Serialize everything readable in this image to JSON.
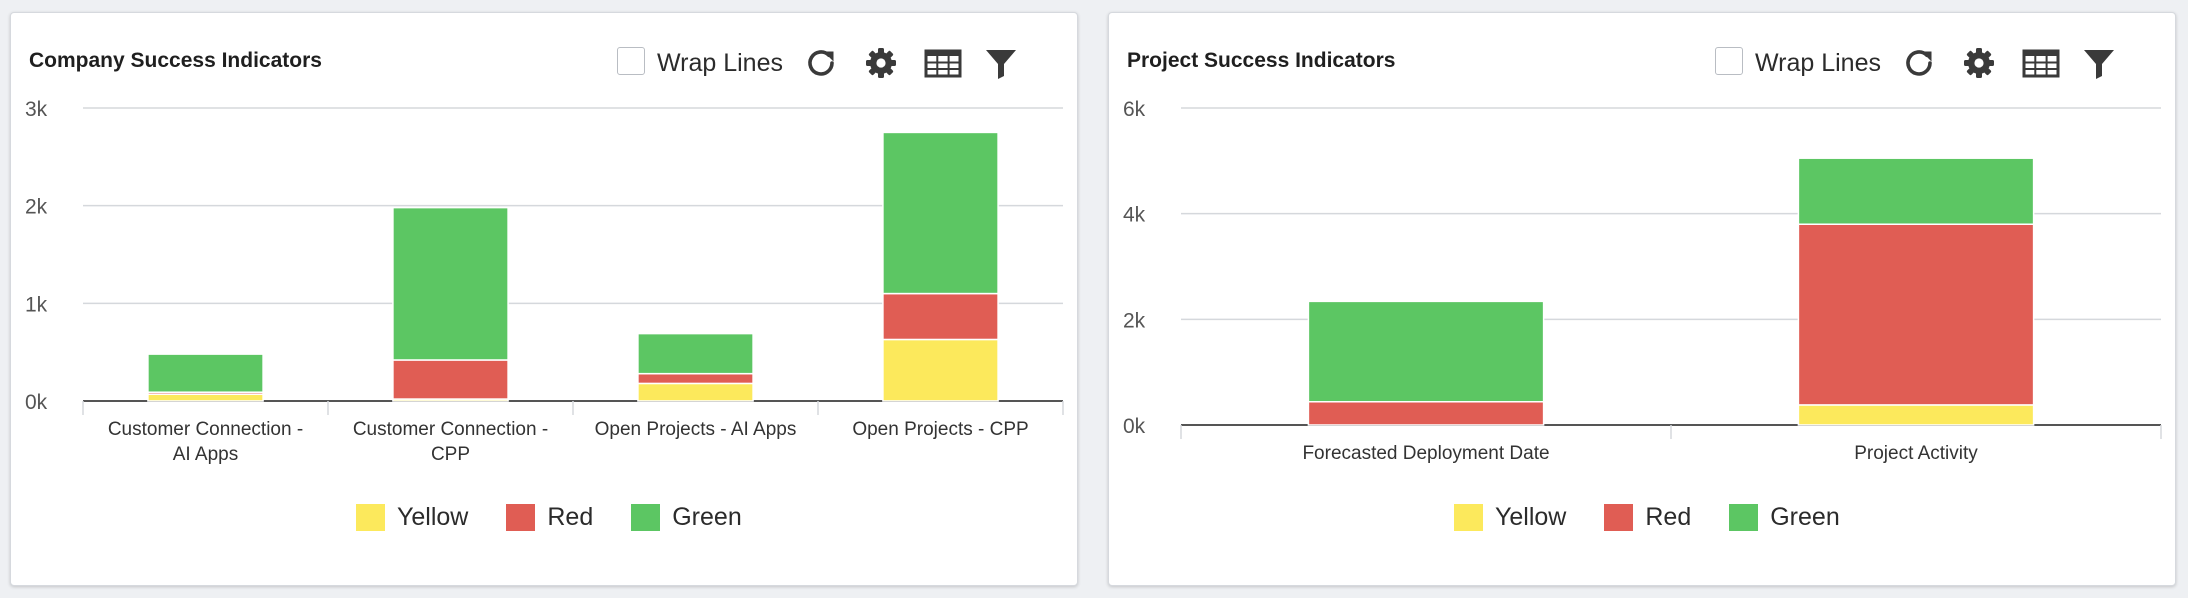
{
  "colors": {
    "yellow": "#fce95c",
    "red": "#e05d54",
    "green": "#5cc663",
    "grid": "#d5d8dc",
    "axis": "#555555",
    "icon": "#3a3a3a"
  },
  "toolbar": {
    "wrap_lines_label": "Wrap Lines",
    "icons": [
      "refresh-icon",
      "gear-icon",
      "table-icon",
      "filter-icon"
    ]
  },
  "panels": [
    {
      "title": "Company Success Indicators"
    },
    {
      "title": "Project Success Indicators"
    }
  ],
  "chart_data": [
    {
      "type": "bar",
      "stacked": true,
      "title": "Company Success Indicators",
      "xlabel": "",
      "ylabel": "",
      "ylim": [
        0,
        3000
      ],
      "yticks": [
        0,
        1000,
        2000,
        3000
      ],
      "ytick_labels": [
        "0k",
        "1k",
        "2k",
        "3k"
      ],
      "grid": true,
      "legend_position": "bottom",
      "categories": [
        [
          "Customer Connection -",
          "AI Apps"
        ],
        [
          "Customer Connection -",
          "CPP"
        ],
        [
          "Open Projects - AI Apps"
        ],
        [
          "Open Projects - CPP"
        ]
      ],
      "series": [
        {
          "name": "Yellow",
          "color_key": "yellow",
          "values": [
            70,
            20,
            180,
            630
          ]
        },
        {
          "name": "Red",
          "color_key": "red",
          "values": [
            20,
            400,
            100,
            470
          ]
        },
        {
          "name": "Green",
          "color_key": "green",
          "values": [
            390,
            1560,
            410,
            1650
          ]
        }
      ]
    },
    {
      "type": "bar",
      "stacked": true,
      "title": "Project Success Indicators",
      "xlabel": "",
      "ylabel": "",
      "ylim": [
        0,
        6000
      ],
      "yticks": [
        0,
        2000,
        4000,
        6000
      ],
      "ytick_labels": [
        "0k",
        "2k",
        "4k",
        "6k"
      ],
      "grid": true,
      "legend_position": "bottom",
      "categories": [
        [
          "Forecasted Deployment Date"
        ],
        [
          "Project Activity"
        ]
      ],
      "series": [
        {
          "name": "Yellow",
          "color_key": "yellow",
          "values": [
            0,
            380
          ]
        },
        {
          "name": "Red",
          "color_key": "red",
          "values": [
            440,
            3420
          ]
        },
        {
          "name": "Green",
          "color_key": "green",
          "values": [
            1900,
            1250
          ]
        }
      ]
    }
  ]
}
